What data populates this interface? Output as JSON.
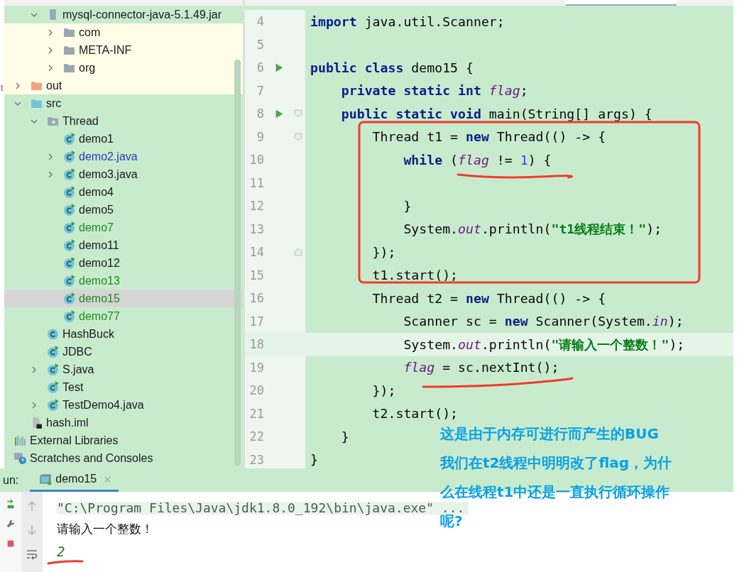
{
  "edge_mark": "t",
  "sidebar": {
    "library_items": [
      {
        "label": "mysql-connector-java-5.1.49.jar",
        "kind": "jar",
        "expanded": true,
        "tinted": false,
        "selected": false,
        "children": [
          {
            "label": "com",
            "kind": "folder",
            "expanded": false,
            "tinted": true,
            "selected": false
          },
          {
            "label": "META-INF",
            "kind": "folder",
            "expanded": false,
            "tinted": true,
            "selected": false
          },
          {
            "label": "org",
            "kind": "folder",
            "expanded": false,
            "tinted": true,
            "selected": false
          }
        ]
      }
    ],
    "project_items": [
      {
        "label": "out",
        "kind": "folder-excluded",
        "expanded": false,
        "tinted": true,
        "selected": false
      },
      {
        "label": "src",
        "kind": "folder-source",
        "expanded": true,
        "tinted": false,
        "selected": false,
        "children": [
          {
            "label": "Thread",
            "kind": "package",
            "expanded": true,
            "tinted": false,
            "selected": false,
            "children": [
              {
                "label": "demo1",
                "kind": "class-run",
                "tinted": false,
                "selected": false
              },
              {
                "label": "demo2.java",
                "kind": "class-run",
                "expanded": false,
                "color": "#2a3cb8",
                "tinted": false,
                "selected": false
              },
              {
                "label": "demo3.java",
                "kind": "class-run",
                "expanded": false,
                "tinted": false,
                "selected": false
              },
              {
                "label": "demo4",
                "kind": "class-run",
                "tinted": false,
                "selected": false
              },
              {
                "label": "demo5",
                "kind": "class-run",
                "tinted": false,
                "selected": false
              },
              {
                "label": "demo7",
                "kind": "class-run",
                "color": "#1f8a1f",
                "tinted": false,
                "selected": false
              },
              {
                "label": "demo11",
                "kind": "class-run",
                "tinted": false,
                "selected": false
              },
              {
                "label": "demo12",
                "kind": "class-run",
                "tinted": false,
                "selected": false
              },
              {
                "label": "demo13",
                "kind": "class-run",
                "color": "#1f8a1f",
                "tinted": false,
                "selected": false
              },
              {
                "label": "demo15",
                "kind": "class-run",
                "color": "#1f8a1f",
                "tinted": false,
                "selected": true
              },
              {
                "label": "demo77",
                "kind": "class-run",
                "color": "#1f8a1f",
                "tinted": false,
                "selected": false
              }
            ]
          },
          {
            "label": "HashBuck",
            "kind": "class",
            "tinted": false,
            "selected": false
          },
          {
            "label": "JDBC",
            "kind": "class-run",
            "tinted": false,
            "selected": false
          },
          {
            "label": "S.java",
            "kind": "class-run",
            "expanded": false,
            "tinted": false,
            "selected": false
          },
          {
            "label": "Test",
            "kind": "class-run",
            "tinted": false,
            "selected": false
          },
          {
            "label": "TestDemo4.java",
            "kind": "class-run",
            "expanded": false,
            "tinted": false,
            "selected": false
          }
        ]
      },
      {
        "label": "hash.iml",
        "kind": "iml",
        "tinted": false,
        "selected": false
      }
    ],
    "root_items": [
      {
        "label": "External Libraries",
        "kind": "libraries",
        "tinted": false,
        "selected": false
      },
      {
        "label": "Scratches and Consoles",
        "kind": "scratches",
        "tinted": false,
        "selected": false
      }
    ]
  },
  "editor": {
    "lines": [
      {
        "num": "4",
        "segs": [
          {
            "t": "import",
            "kind": "keyword"
          },
          {
            "t": " java.util.Scanner;",
            "kind": "plain"
          }
        ]
      },
      {
        "num": "5"
      },
      {
        "num": "6",
        "run": true,
        "segs": [
          {
            "t": "public class",
            "kind": "keyword"
          },
          {
            "t": " demo15 {",
            "kind": "plain"
          }
        ]
      },
      {
        "num": "7",
        "segs": [
          {
            "t": "    private static int ",
            "kind": "keyword"
          },
          {
            "t": "flag",
            "kind": "field"
          },
          {
            "t": ";",
            "kind": "plain"
          }
        ]
      },
      {
        "num": "8",
        "run": true,
        "fold_start": true,
        "segs": [
          {
            "t": "    public static void",
            "kind": "keyword"
          },
          {
            "t": " main(String[] args) {",
            "kind": "plain"
          }
        ]
      },
      {
        "num": "9",
        "fold_start": true,
        "segs": [
          {
            "t": "        Thread t1 = ",
            "kind": "plain"
          },
          {
            "t": "new",
            "kind": "keyword"
          },
          {
            "t": " Thread(() -> {",
            "kind": "plain"
          }
        ]
      },
      {
        "num": "10",
        "segs": [
          {
            "t": "            while",
            "kind": "keyword"
          },
          {
            "t": " (",
            "kind": "plain"
          },
          {
            "t": "flag",
            "kind": "field"
          },
          {
            "t": " != ",
            "kind": "plain"
          },
          {
            "t": "1",
            "kind": "number"
          },
          {
            "t": ") {",
            "kind": "plain"
          }
        ]
      },
      {
        "num": "11"
      },
      {
        "num": "12",
        "segs": [
          {
            "t": "            }",
            "kind": "plain"
          }
        ]
      },
      {
        "num": "13",
        "segs": [
          {
            "t": "            System.",
            "kind": "plain"
          },
          {
            "t": "out",
            "kind": "field"
          },
          {
            "t": ".println(",
            "kind": "plain"
          },
          {
            "t": "\"t1线程结束！\"",
            "kind": "string"
          },
          {
            "t": ");",
            "kind": "plain"
          }
        ]
      },
      {
        "num": "14",
        "fold_end": true,
        "segs": [
          {
            "t": "        });",
            "kind": "plain"
          }
        ]
      },
      {
        "num": "15",
        "segs": [
          {
            "t": "        t1.start();",
            "kind": "plain"
          }
        ]
      },
      {
        "num": "16",
        "segs": [
          {
            "t": "        Thread t2 = ",
            "kind": "plain"
          },
          {
            "t": "new",
            "kind": "keyword"
          },
          {
            "t": " Thread(() -> {",
            "kind": "plain"
          }
        ]
      },
      {
        "num": "17",
        "segs": [
          {
            "t": "            Scanner sc = ",
            "kind": "plain"
          },
          {
            "t": "new",
            "kind": "keyword"
          },
          {
            "t": " Scanner(System.",
            "kind": "plain"
          },
          {
            "t": "in",
            "kind": "field"
          },
          {
            "t": ");",
            "kind": "plain"
          }
        ]
      },
      {
        "num": "18",
        "current": true,
        "segs": [
          {
            "t": "            System.",
            "kind": "plain"
          },
          {
            "t": "out",
            "kind": "field"
          },
          {
            "t": ".println(",
            "kind": "plain"
          },
          {
            "t": "\"请输入一个整数！\"",
            "kind": "string"
          },
          {
            "t": ");",
            "kind": "plain"
          }
        ]
      },
      {
        "num": "19",
        "segs": [
          {
            "t": "            flag",
            "kind": "field"
          },
          {
            "t": " = sc.nextInt();",
            "kind": "plain"
          }
        ]
      },
      {
        "num": "20",
        "segs": [
          {
            "t": "        });",
            "kind": "plain"
          }
        ]
      },
      {
        "num": "21",
        "segs": [
          {
            "t": "        t2.start();",
            "kind": "plain"
          }
        ]
      },
      {
        "num": "22",
        "segs": [
          {
            "t": "    }",
            "kind": "plain"
          }
        ]
      },
      {
        "num": "23",
        "segs": [
          {
            "t": "}",
            "kind": "plain"
          }
        ]
      }
    ]
  },
  "run_panel": {
    "label": "un:",
    "tabs": [
      {
        "label": "demo15",
        "selected": true
      }
    ],
    "console": [
      {
        "text": "\"C:\\Program Files\\Java\\jdk1.8.0_192\\bin\\java.exe\" ...",
        "kind": "command"
      },
      {
        "text": "请输入一个整数！",
        "kind": "output"
      },
      {
        "text": "2",
        "kind": "input"
      }
    ]
  },
  "annotation": {
    "lines": [
      "这是由于内存可进行而产生的BUG",
      "我们在t2线程中明明改了flag，为什",
      "么在线程t1中还是一直执行循环操作",
      "呢?"
    ]
  }
}
